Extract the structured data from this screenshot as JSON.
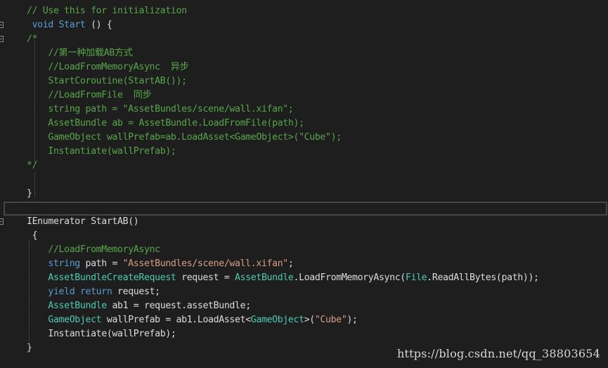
{
  "editor": {
    "colors": {
      "background": "#1e1e1e",
      "comment": "#57a64a",
      "keyword": "#569cd6",
      "type": "#4ec9b0",
      "string": "#d69d85",
      "plain": "#dcdcdc"
    },
    "lines": [
      [
        {
          "t": "comment",
          "s": "// Use this for initialization"
        }
      ],
      [
        {
          "t": "plain",
          "s": " "
        },
        {
          "t": "keyword",
          "s": "void"
        },
        {
          "t": "plain",
          "s": " "
        },
        {
          "t": "keyword",
          "s": "Start"
        },
        {
          "t": "plain",
          "s": " () {"
        }
      ],
      [
        {
          "t": "comment",
          "s": "/*"
        }
      ],
      [
        {
          "t": "comment",
          "s": "    //第一种加载AB方式"
        }
      ],
      [
        {
          "t": "comment",
          "s": "    //LoadFromMemoryAsync  异步"
        }
      ],
      [
        {
          "t": "comment",
          "s": "    StartCoroutine(StartAB());"
        }
      ],
      [
        {
          "t": "comment",
          "s": "    //LoadFromFile  同步"
        }
      ],
      [
        {
          "t": "comment",
          "s": "    string path = \"AssetBundles/scene/wall.xifan\";"
        }
      ],
      [
        {
          "t": "comment",
          "s": "    AssetBundle ab = AssetBundle.LoadFromFile(path);"
        }
      ],
      [
        {
          "t": "comment",
          "s": "    GameObject wallPrefab=ab.LoadAsset<GameObject>(\"Cube\");"
        }
      ],
      [
        {
          "t": "comment",
          "s": "    Instantiate(wallPrefab);"
        }
      ],
      [
        {
          "t": "comment",
          "s": "*/"
        }
      ],
      [],
      [
        {
          "t": "plain",
          "s": "}"
        }
      ],
      [],
      [
        {
          "t": "plain",
          "s": "IEnumerator StartAB()"
        }
      ],
      [
        {
          "t": "plain",
          "s": " {"
        }
      ],
      [
        {
          "t": "plain",
          "s": "    "
        },
        {
          "t": "comment",
          "s": "//LoadFromMemoryAsync"
        }
      ],
      [
        {
          "t": "plain",
          "s": "    "
        },
        {
          "t": "keyword",
          "s": "string"
        },
        {
          "t": "plain",
          "s": " path = "
        },
        {
          "t": "string",
          "s": "\"AssetBundles/scene/wall.xifan\""
        },
        {
          "t": "plain",
          "s": ";"
        }
      ],
      [
        {
          "t": "plain",
          "s": "    "
        },
        {
          "t": "type",
          "s": "AssetBundleCreateRequest"
        },
        {
          "t": "plain",
          "s": " request = "
        },
        {
          "t": "type",
          "s": "AssetBundle"
        },
        {
          "t": "plain",
          "s": ".LoadFromMemoryAsync("
        },
        {
          "t": "type",
          "s": "File"
        },
        {
          "t": "plain",
          "s": ".ReadAllBytes(path));"
        }
      ],
      [
        {
          "t": "plain",
          "s": "    "
        },
        {
          "t": "keyword",
          "s": "yield"
        },
        {
          "t": "plain",
          "s": " "
        },
        {
          "t": "keyword",
          "s": "return"
        },
        {
          "t": "plain",
          "s": " request;"
        }
      ],
      [
        {
          "t": "plain",
          "s": "    "
        },
        {
          "t": "type",
          "s": "AssetBundle"
        },
        {
          "t": "plain",
          "s": " ab1 = request.assetBundle;"
        }
      ],
      [
        {
          "t": "plain",
          "s": "    "
        },
        {
          "t": "type",
          "s": "GameObject"
        },
        {
          "t": "plain",
          "s": " wallPrefab = ab1.LoadAsset<"
        },
        {
          "t": "type",
          "s": "GameObject"
        },
        {
          "t": "plain",
          "s": ">("
        },
        {
          "t": "string",
          "s": "\"Cube\""
        },
        {
          "t": "plain",
          "s": ");"
        }
      ],
      [
        {
          "t": "plain",
          "s": "    Instantiate(wallPrefab);"
        }
      ],
      [
        {
          "t": "plain",
          "s": "}"
        }
      ]
    ]
  },
  "watermark": "https://blog.csdn.net/qq_38803654"
}
